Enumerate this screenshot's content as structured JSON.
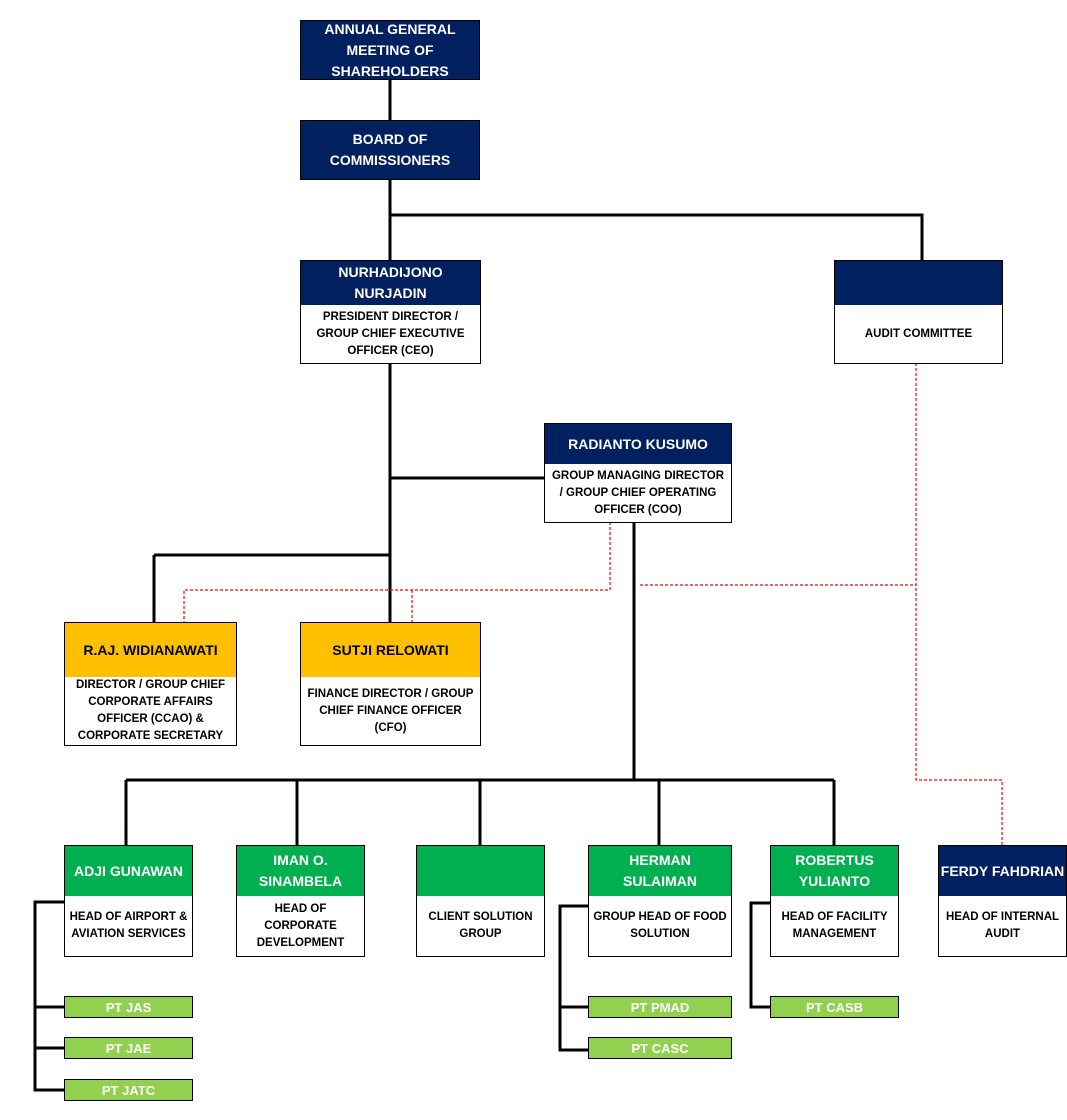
{
  "colors": {
    "navy": "#002060",
    "green": "#00B050",
    "yellow": "#FFC000",
    "light_green": "#92D050",
    "dotted_line": "#FF0000"
  },
  "agm": {
    "title": "ANNUAL GENERAL MEETING OF SHAREHOLDERS"
  },
  "boc": {
    "title": "BOARD OF COMMISSIONERS"
  },
  "ceo": {
    "name": "NURHADIJONO NURJADIN",
    "role": "PRESIDENT DIRECTOR / GROUP CHIEF EXECUTIVE OFFICER (CEO)"
  },
  "audit_committee": {
    "name": "",
    "role": "AUDIT COMMITTEE"
  },
  "coo": {
    "name": "RADIANTO KUSUMO",
    "role": "GROUP MANAGING DIRECTOR / GROUP CHIEF OPERATING OFFICER (COO)"
  },
  "ccao": {
    "name": "R.AJ. WIDIANAWATI",
    "role": "DIRECTOR / GROUP CHIEF CORPORATE AFFAIRS OFFICER (CCAO) & CORPORATE SECRETARY"
  },
  "cfo": {
    "name": "SUTJI RELOWATI",
    "role": "FINANCE DIRECTOR / GROUP CHIEF FINANCE OFFICER (CFO)"
  },
  "heads": [
    {
      "name": "ADJI GUNAWAN",
      "role": "HEAD OF AIRPORT & AVIATION SERVICES"
    },
    {
      "name": "IMAN O. SINAMBELA",
      "role": "HEAD OF CORPORATE DEVELOPMENT"
    },
    {
      "name": "",
      "role": "CLIENT SOLUTION GROUP"
    },
    {
      "name": "HERMAN SULAIMAN",
      "role": "GROUP HEAD OF FOOD SOLUTION"
    },
    {
      "name": "ROBERTUS YULIANTO",
      "role": "HEAD OF FACILITY MANAGEMENT"
    },
    {
      "name": "FERDY FAHDRIAN",
      "role": "HEAD OF INTERNAL AUDIT"
    }
  ],
  "subsidiaries": {
    "airport": [
      "PT JAS",
      "PT JAE",
      "PT JATC"
    ],
    "food": [
      "PT PMAD",
      "PT CASC"
    ],
    "facility": [
      "PT CASB"
    ]
  }
}
